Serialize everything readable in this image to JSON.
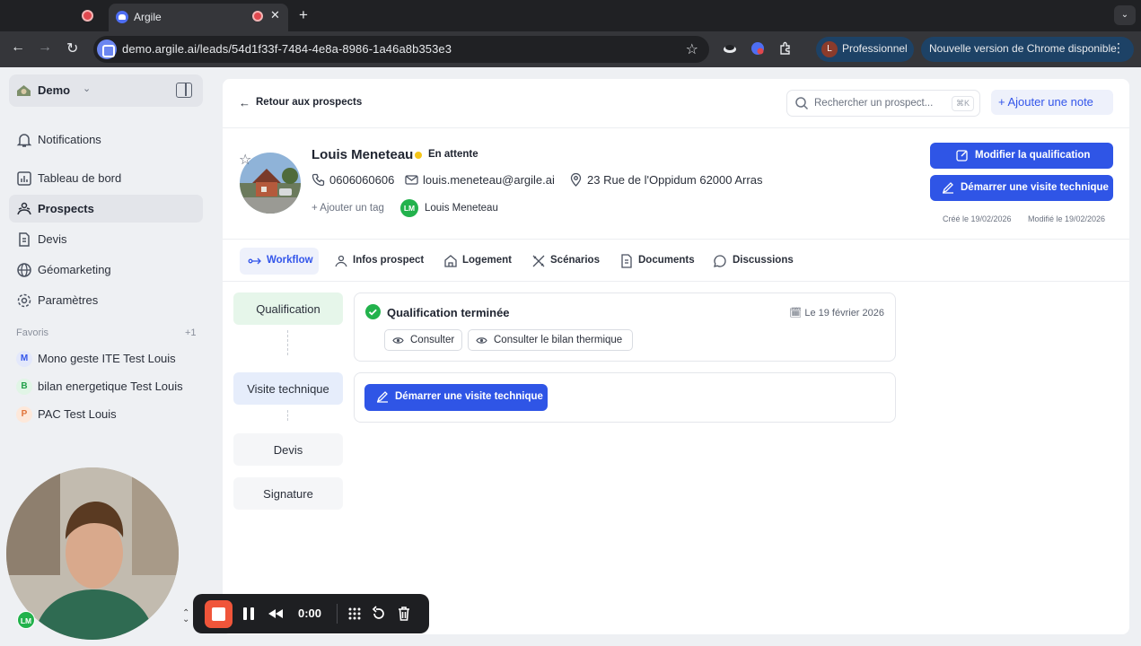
{
  "browser": {
    "tab_title": "Argile",
    "url": "demo.argile.ai/leads/54d1f33f-7484-4e8a-8986-1a46a8b353e3",
    "profile_initial": "L",
    "profile_label": "Professionnel",
    "update_label": "Nouvelle version de Chrome disponible"
  },
  "sidebar": {
    "workspace": "Demo",
    "items": [
      {
        "label": "Notifications",
        "icon": "bell-icon"
      },
      {
        "label": "Tableau de bord",
        "icon": "dashboard-icon"
      },
      {
        "label": "Prospects",
        "icon": "people-icon",
        "active": true
      },
      {
        "label": "Devis",
        "icon": "document-icon"
      },
      {
        "label": "Géomarketing",
        "icon": "globe-icon"
      },
      {
        "label": "Paramètres",
        "icon": "gear-icon"
      }
    ],
    "favorites_title": "Favoris",
    "favorites_count": "+1",
    "favorites": [
      {
        "badge": "M",
        "label": "Mono geste ITE Test Louis"
      },
      {
        "badge": "B",
        "label": "bilan energetique Test Louis"
      },
      {
        "badge": "P",
        "label": "PAC Test Louis"
      }
    ]
  },
  "header": {
    "back_label": "Retour aux prospects",
    "search_placeholder": "Rechercher un prospect...",
    "search_shortcut": "⌘K",
    "add_note_label": "Ajouter une note"
  },
  "lead": {
    "name": "Louis Meneteau",
    "status": "En attente",
    "phone": "0606060606",
    "email": "louis.meneteau@argile.ai",
    "address": "23 Rue de l'Oppidum 62000 Arras",
    "add_tag": "Ajouter un tag",
    "owner_initials": "LM",
    "owner_name": "Louis Meneteau",
    "btn_modify": "Modifier la qualification",
    "btn_start_visit": "Démarrer une visite technique",
    "created": "Créé le 19/02/2026",
    "modified": "Modifié le 19/02/2026"
  },
  "tabs": [
    "Workflow",
    "Infos prospect",
    "Logement",
    "Scénarios",
    "Documents",
    "Discussions"
  ],
  "workflow": {
    "steps": [
      "Qualification",
      "Visite technique",
      "Devis",
      "Signature"
    ],
    "qualification_title": "Qualification terminée",
    "qualification_date": "Le 19 février 2026",
    "consult_label": "Consulter",
    "consult_thermal_label": "Consulter le bilan thermique",
    "visit_button": "Démarrer une visite technique"
  },
  "recorder": {
    "time": "0:00",
    "overlay_initials": "LM"
  },
  "colors": {
    "primary": "#2f55e6",
    "success": "#22b24c",
    "pending": "#f5c518"
  }
}
